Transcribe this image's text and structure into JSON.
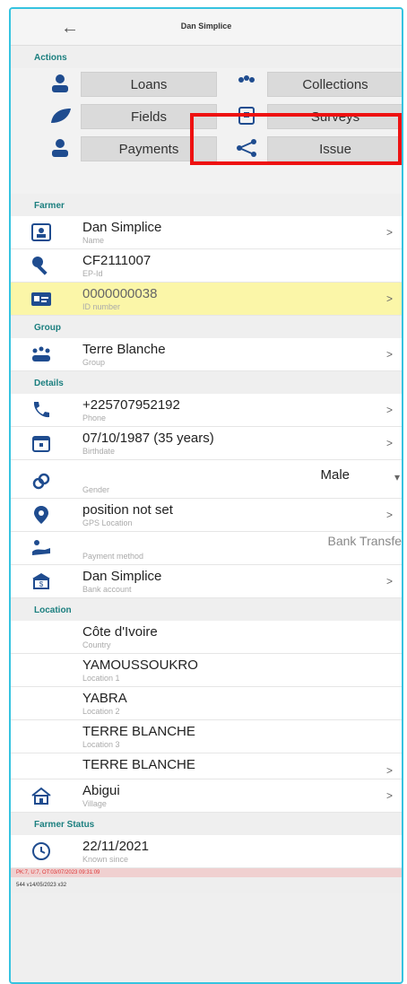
{
  "header": {
    "title": "Dan Simplice",
    "back_icon": "arrow-left-icon"
  },
  "actions": {
    "heading": "Actions",
    "buttons": [
      {
        "label": "Loans",
        "icon": "person-icon"
      },
      {
        "label": "Collections",
        "icon": "people-icon"
      },
      {
        "label": "Fields",
        "icon": "leaf-icon"
      },
      {
        "label": "Surveys",
        "icon": "survey-icon"
      },
      {
        "label": "Payments",
        "icon": "person-icon"
      },
      {
        "label": "Issue",
        "icon": "share-icon"
      }
    ]
  },
  "farmer": {
    "heading": "Farmer",
    "rows": [
      {
        "value": "Dan Simplice",
        "sub": "Name"
      },
      {
        "value": "CF2111007",
        "sub": "EP-Id"
      },
      {
        "value": "0000000038",
        "sub": "ID number"
      }
    ]
  },
  "group": {
    "heading": "Group",
    "rows": [
      {
        "value": "Terre Blanche",
        "sub": "Group"
      }
    ]
  },
  "details": {
    "heading": "Details",
    "rows": [
      {
        "value": "+225707952192",
        "sub": "Phone"
      },
      {
        "value": "07/10/1987 (35 years)",
        "sub": "Birthdate"
      },
      {
        "value": "Male",
        "sub": "Gender"
      },
      {
        "value": "position not set",
        "sub": "GPS Location"
      },
      {
        "value": "Bank Transfe",
        "sub": "Payment method"
      },
      {
        "value": "Dan Simplice",
        "sub": "Bank account"
      }
    ]
  },
  "location": {
    "heading": "Location",
    "rows": [
      {
        "value": "Côte d'Ivoire",
        "sub": "Country"
      },
      {
        "value": "YAMOUSSOUKRO",
        "sub": "Location 1"
      },
      {
        "value": "YABRA",
        "sub": "Location 2"
      },
      {
        "value": "TERRE BLANCHE",
        "sub": "Location 3"
      },
      {
        "value": "TERRE BLANCHE",
        "sub": ""
      },
      {
        "value": "Abigui",
        "sub": "Village"
      }
    ]
  },
  "status": {
    "heading": "Farmer Status",
    "rows": [
      {
        "value": "22/11/2021",
        "sub": "Known since"
      }
    ]
  },
  "footer": {
    "line1": "PK:7, U:7, OT:03/07/2023 09:31:09",
    "line2": "544 v14/05/2023 x32"
  },
  "chevron": ">",
  "colors": {
    "accent": "#1b7f7f",
    "highlight": "#fbf6a8",
    "annotation": "#ee1111"
  }
}
